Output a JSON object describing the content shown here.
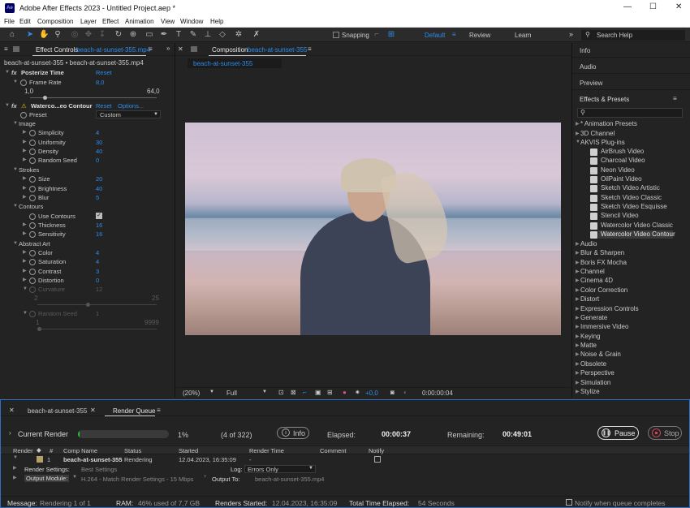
{
  "titlebar": {
    "title": "Adobe After Effects 2023 - Untitled Project.aep *",
    "logo": "Ae"
  },
  "menu": [
    "File",
    "Edit",
    "Composition",
    "Layer",
    "Effect",
    "Animation",
    "View",
    "Window",
    "Help"
  ],
  "toolbar": {
    "snapping": "Snapping",
    "workspaces": [
      "Default",
      "Review",
      "Learn"
    ],
    "search": "Search Help"
  },
  "effect_controls": {
    "tab": "Effect Controls",
    "tab_file": "beach-at-sunset-355.mp4",
    "breadcrumb": "beach-at-sunset-355 • beach-at-sunset-355.mp4",
    "posterize": {
      "name": "Posterize Time",
      "reset": "Reset",
      "frame_rate_label": "Frame Rate",
      "frame_rate": "8,0",
      "min": "1,0",
      "max": "64,0"
    },
    "watercolor": {
      "name": "Waterco...eo Contour",
      "reset": "Reset",
      "options": "Options...",
      "preset_label": "Preset",
      "preset": "Custom"
    },
    "groups": {
      "image": "Image",
      "strokes": "Strokes",
      "contours": "Contours",
      "abstract": "Abstract Art"
    },
    "params": [
      {
        "label": "Simplicity",
        "value": "4"
      },
      {
        "label": "Uniformity",
        "value": "30"
      },
      {
        "label": "Density",
        "value": "40"
      },
      {
        "label": "Random Seed",
        "value": "0"
      },
      {
        "label": "Size",
        "value": "20"
      },
      {
        "label": "Brightness",
        "value": "40"
      },
      {
        "label": "Blur",
        "value": "5"
      },
      {
        "label": "Use Contours",
        "value": ""
      },
      {
        "label": "Thickness",
        "value": "16"
      },
      {
        "label": "Sensitivity",
        "value": "16"
      },
      {
        "label": "Color",
        "value": "4"
      },
      {
        "label": "Saturation",
        "value": "4"
      },
      {
        "label": "Contrast",
        "value": "3"
      },
      {
        "label": "Distortion",
        "value": "0"
      }
    ],
    "curvature": {
      "label": "Curvature",
      "value": "12",
      "min": "2",
      "max": "25"
    },
    "random_seed2": {
      "label": "Random Seed",
      "value": "1",
      "min": "1",
      "max": "9999"
    }
  },
  "composition": {
    "tab": "Composition",
    "tab_file": "beach-at-sunset-355",
    "subtab": "beach-at-sunset-355",
    "zoom": "(20%)",
    "resolution": "Full",
    "exposure": "+0,0",
    "timecode": "0:00:00:04"
  },
  "right_panels": {
    "info": "Info",
    "audio": "Audio",
    "preview": "Preview",
    "effects": "Effects & Presets"
  },
  "effects_list": {
    "top": [
      "* Animation Presets",
      "3D Channel",
      "AKVIS Plug-ins"
    ],
    "akvis": [
      "AirBrush Video",
      "Charcoal Video",
      "Neon Video",
      "OilPaint Video",
      "Sketch Video Artistic",
      "Sketch Video Classic",
      "Sketch Video Esquisse",
      "Stencil Video",
      "Watercolor Video Classic",
      "Watercolor Video Contour"
    ],
    "rest": [
      "Audio",
      "Blur & Sharpen",
      "Boris FX Mocha",
      "Channel",
      "Cinema 4D",
      "Color Correction",
      "Distort",
      "Expression Controls",
      "Generate",
      "Immersive Video",
      "Keying",
      "Matte",
      "Noise & Grain",
      "Obsolete",
      "Perspective",
      "Simulation",
      "Stylize"
    ]
  },
  "render_queue": {
    "tabs": [
      "beach-at-sunset-355",
      "Render Queue"
    ],
    "current_render": "Current Render",
    "progress": 0.01,
    "percent": "1%",
    "count": "(4 of 322)",
    "info": "Info",
    "elapsed_label": "Elapsed:",
    "elapsed": "00:00:37",
    "remaining_label": "Remaining:",
    "remaining": "00:49:01",
    "pause": "Pause",
    "stop": "Stop",
    "headers": [
      "Render",
      "#",
      "Comp Name",
      "Status",
      "Started",
      "Render Time",
      "Comment",
      "Notify"
    ],
    "row": {
      "num": "1",
      "comp": "beach-at-sunset-355",
      "status": "Rendering",
      "started": "12.04.2023, 16:35:09",
      "render_time": "-"
    },
    "render_settings_label": "Render Settings:",
    "render_settings": "Best Settings",
    "log_label": "Log:",
    "log": "Errors Only",
    "output_module_label": "Output Module:",
    "output_module": "H.264 - Match Render Settings - 15 Mbps",
    "output_to_label": "Output To:",
    "output_to": "beach-at-sunset-355.mp4"
  },
  "statusbar": {
    "message_label": "Message:",
    "message": "Rendering 1 of 1",
    "ram_label": "RAM:",
    "ram": "46% used of 7,7 GB",
    "renders_started_label": "Renders Started:",
    "renders_started": "12.04.2023, 16:35:09",
    "total_label": "Total Time Elapsed:",
    "total": "54 Seconds",
    "notify": "Notify when queue completes"
  }
}
